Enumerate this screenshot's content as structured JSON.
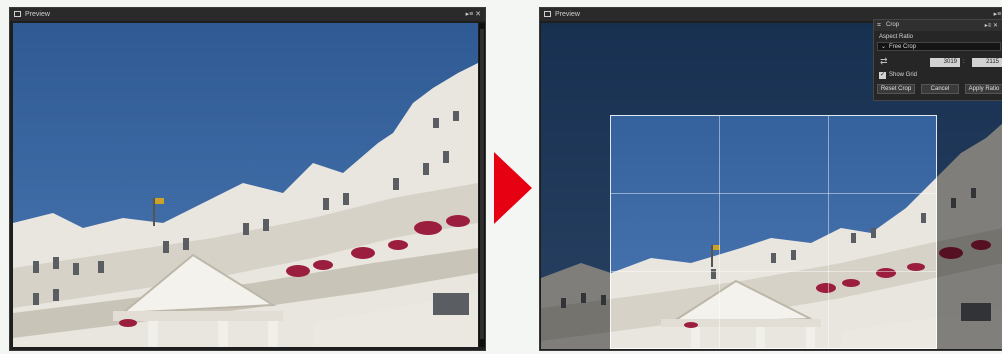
{
  "left_window": {
    "title": "Preview",
    "controls": "▸≡ ✕"
  },
  "right_window": {
    "title": "Preview",
    "controls": "▸≡ ✕"
  },
  "crop_dialog": {
    "title": "Crop",
    "controls": "▸≡ ✕",
    "aspect_ratio_label": "Aspect Ratio",
    "aspect_ratio_value": "Free Crop",
    "width_value": "3019",
    "separator": ":",
    "height_value": "2115",
    "show_grid_checked": true,
    "show_grid_label": "Show Grid",
    "reset_button": "Reset Crop",
    "cancel_button": "Cancel",
    "apply_button": "Apply Ratio"
  },
  "colors": {
    "arrow": "#e60012",
    "sky": "#365f95",
    "window_bg": "#1e1e1e"
  },
  "icons": {
    "arrow": "right-pointing-triangle",
    "crop_icon": "crop-icon",
    "rotate_icon": "rotate-aspect-icon",
    "checkbox": "checkbox-checked-icon",
    "chevron": "chevron-down-icon"
  }
}
